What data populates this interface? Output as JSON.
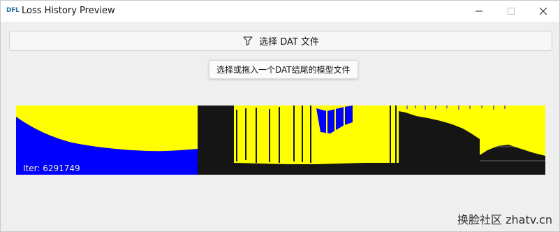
{
  "window": {
    "app_icon_text": "DFL",
    "title": "Loss History Preview",
    "controls": {
      "minimize": "minimize",
      "maximize": "maximize",
      "close": "close"
    }
  },
  "toolbar": {
    "select_button_label": "选择 DAT 文件",
    "select_button_icon": "filter-icon"
  },
  "tooltip": {
    "text": "选择或拖入一个DAT结尾的模型文件"
  },
  "chart": {
    "iter_label": "Iter: 6291749"
  },
  "watermark": {
    "text": "换脸社区 zhatv.cn"
  },
  "colors": {
    "background": "#efefef",
    "titlebar": "#ffffff",
    "chart_background": "#151515",
    "series_yellow": "#ffff00",
    "series_blue": "#0000ff"
  },
  "chart_data": {
    "type": "area",
    "title": "",
    "xlabel": "",
    "ylabel": "",
    "xlim": [
      0,
      6291749
    ],
    "ylim": [
      0,
      1
    ],
    "grid": true,
    "legend": "none",
    "series": [
      {
        "color": "#ffff00",
        "values": []
      },
      {
        "color": "#0000ff",
        "values": []
      },
      {
        "color": "#151515",
        "values": []
      }
    ]
  }
}
